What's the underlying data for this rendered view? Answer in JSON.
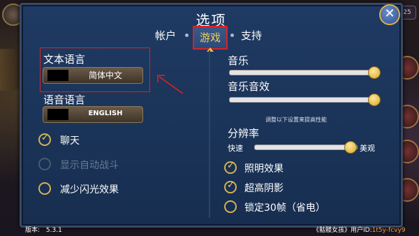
{
  "dialog": {
    "title": "选项",
    "close_icon": "✕"
  },
  "tabs": [
    {
      "label": "帐户",
      "active": false
    },
    {
      "label": "游戏",
      "active": true
    },
    {
      "label": "支持",
      "active": false
    }
  ],
  "left": {
    "text_language": {
      "label": "文本语言",
      "value": "简体中文"
    },
    "voice_language": {
      "label": "语音语言",
      "value": "ENGLISH"
    },
    "options": [
      {
        "label": "聊天",
        "checked": true,
        "disabled": false
      },
      {
        "label": "显示自动战斗",
        "checked": false,
        "disabled": true
      },
      {
        "label": "减少闪光效果",
        "checked": false,
        "disabled": false
      }
    ]
  },
  "right": {
    "music": {
      "label": "音乐",
      "level": 1.0
    },
    "music_sfx": {
      "label": "音乐音效",
      "level": 1.0
    },
    "perf_note": "调整以下设置来提高性能",
    "resolution": {
      "label": "分辨率",
      "min_label": "快速",
      "max_label": "美观",
      "level": 0.93
    },
    "options": [
      {
        "label": "照明效果",
        "checked": true
      },
      {
        "label": "超高阴影",
        "checked": true
      },
      {
        "label": "锁定30帧（省电）",
        "checked": false
      }
    ]
  },
  "footer": {
    "version_label": "版本:",
    "version": "5.3.1",
    "game_title": "《骷髅女孩》用户ID:",
    "user_id": "1t5y-fcvy9"
  },
  "background": {
    "badge": "25"
  },
  "colors": {
    "panel": "#1f3a63",
    "accent_gold": "#f2cf58",
    "highlight_red": "#e02020"
  }
}
